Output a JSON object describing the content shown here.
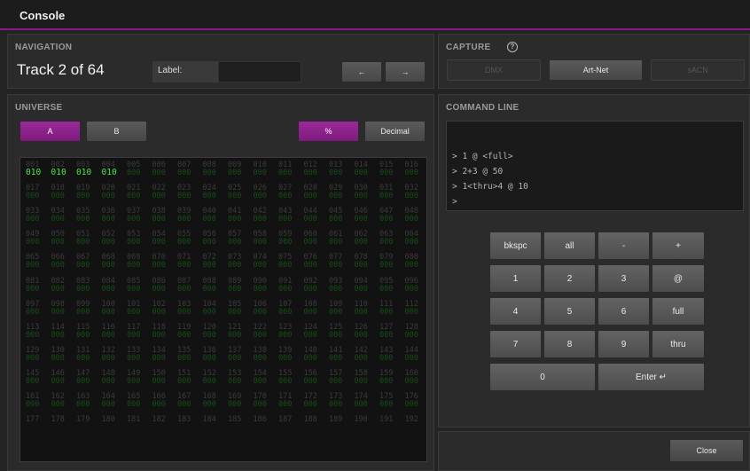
{
  "window": {
    "title": "Console"
  },
  "navigation": {
    "header": "NAVIGATION",
    "track_text": "Track 2 of 64",
    "label_caption": "Label:",
    "label_value": "",
    "prev_label": "←",
    "next_label": "→"
  },
  "capture": {
    "header": "CAPTURE",
    "help_icon": "question-circle-icon",
    "buttons": [
      "DMX",
      "Art-Net",
      "sACN"
    ]
  },
  "universe": {
    "header": "UNIVERSE",
    "tab_a": "A",
    "tab_b": "B",
    "mode_percent": "%",
    "mode_decimal": "Decimal",
    "cells": [
      {
        "ch": "001",
        "val": "010"
      },
      {
        "ch": "002",
        "val": "010"
      },
      {
        "ch": "003",
        "val": "010"
      },
      {
        "ch": "004",
        "val": "010"
      },
      {
        "ch": "005",
        "val": "000"
      },
      {
        "ch": "006",
        "val": "000"
      },
      {
        "ch": "007",
        "val": "000"
      },
      {
        "ch": "008",
        "val": "000"
      },
      {
        "ch": "009",
        "val": "000"
      },
      {
        "ch": "010",
        "val": "000"
      },
      {
        "ch": "011",
        "val": "000"
      },
      {
        "ch": "012",
        "val": "000"
      },
      {
        "ch": "013",
        "val": "000"
      },
      {
        "ch": "014",
        "val": "000"
      },
      {
        "ch": "015",
        "val": "000"
      },
      {
        "ch": "016",
        "val": "000"
      },
      {
        "ch": "017",
        "val": "000"
      },
      {
        "ch": "018",
        "val": "000"
      },
      {
        "ch": "019",
        "val": "000"
      },
      {
        "ch": "020",
        "val": "000"
      },
      {
        "ch": "021",
        "val": "000"
      },
      {
        "ch": "022",
        "val": "000"
      },
      {
        "ch": "023",
        "val": "000"
      },
      {
        "ch": "024",
        "val": "000"
      },
      {
        "ch": "025",
        "val": "000"
      },
      {
        "ch": "026",
        "val": "000"
      },
      {
        "ch": "027",
        "val": "000"
      },
      {
        "ch": "028",
        "val": "000"
      },
      {
        "ch": "029",
        "val": "000"
      },
      {
        "ch": "030",
        "val": "000"
      },
      {
        "ch": "031",
        "val": "000"
      },
      {
        "ch": "032",
        "val": "000"
      },
      {
        "ch": "033",
        "val": "000"
      },
      {
        "ch": "034",
        "val": "000"
      },
      {
        "ch": "035",
        "val": "000"
      },
      {
        "ch": "036",
        "val": "000"
      },
      {
        "ch": "037",
        "val": "000"
      },
      {
        "ch": "038",
        "val": "000"
      },
      {
        "ch": "039",
        "val": "000"
      },
      {
        "ch": "040",
        "val": "000"
      },
      {
        "ch": "041",
        "val": "000"
      },
      {
        "ch": "042",
        "val": "000"
      },
      {
        "ch": "043",
        "val": "000"
      },
      {
        "ch": "044",
        "val": "000"
      },
      {
        "ch": "045",
        "val": "000"
      },
      {
        "ch": "046",
        "val": "000"
      },
      {
        "ch": "047",
        "val": "000"
      },
      {
        "ch": "048",
        "val": "000"
      },
      {
        "ch": "049",
        "val": "000"
      },
      {
        "ch": "050",
        "val": "000"
      },
      {
        "ch": "051",
        "val": "000"
      },
      {
        "ch": "052",
        "val": "000"
      },
      {
        "ch": "053",
        "val": "000"
      },
      {
        "ch": "054",
        "val": "000"
      },
      {
        "ch": "055",
        "val": "000"
      },
      {
        "ch": "056",
        "val": "000"
      },
      {
        "ch": "057",
        "val": "000"
      },
      {
        "ch": "058",
        "val": "000"
      },
      {
        "ch": "059",
        "val": "000"
      },
      {
        "ch": "060",
        "val": "000"
      },
      {
        "ch": "061",
        "val": "000"
      },
      {
        "ch": "062",
        "val": "000"
      },
      {
        "ch": "063",
        "val": "000"
      },
      {
        "ch": "064",
        "val": "000"
      },
      {
        "ch": "065",
        "val": "000"
      },
      {
        "ch": "066",
        "val": "000"
      },
      {
        "ch": "067",
        "val": "000"
      },
      {
        "ch": "068",
        "val": "000"
      },
      {
        "ch": "069",
        "val": "000"
      },
      {
        "ch": "070",
        "val": "000"
      },
      {
        "ch": "071",
        "val": "000"
      },
      {
        "ch": "072",
        "val": "000"
      },
      {
        "ch": "073",
        "val": "000"
      },
      {
        "ch": "074",
        "val": "000"
      },
      {
        "ch": "075",
        "val": "000"
      },
      {
        "ch": "076",
        "val": "000"
      },
      {
        "ch": "077",
        "val": "000"
      },
      {
        "ch": "078",
        "val": "000"
      },
      {
        "ch": "079",
        "val": "000"
      },
      {
        "ch": "080",
        "val": "000"
      },
      {
        "ch": "081",
        "val": "000"
      },
      {
        "ch": "082",
        "val": "000"
      },
      {
        "ch": "083",
        "val": "000"
      },
      {
        "ch": "084",
        "val": "000"
      },
      {
        "ch": "085",
        "val": "000"
      },
      {
        "ch": "086",
        "val": "000"
      },
      {
        "ch": "087",
        "val": "000"
      },
      {
        "ch": "088",
        "val": "000"
      },
      {
        "ch": "089",
        "val": "000"
      },
      {
        "ch": "090",
        "val": "000"
      },
      {
        "ch": "091",
        "val": "000"
      },
      {
        "ch": "092",
        "val": "000"
      },
      {
        "ch": "093",
        "val": "000"
      },
      {
        "ch": "094",
        "val": "000"
      },
      {
        "ch": "095",
        "val": "000"
      },
      {
        "ch": "096",
        "val": "000"
      },
      {
        "ch": "097",
        "val": "000"
      },
      {
        "ch": "098",
        "val": "000"
      },
      {
        "ch": "099",
        "val": "000"
      },
      {
        "ch": "100",
        "val": "000"
      },
      {
        "ch": "101",
        "val": "000"
      },
      {
        "ch": "102",
        "val": "000"
      },
      {
        "ch": "103",
        "val": "000"
      },
      {
        "ch": "104",
        "val": "000"
      },
      {
        "ch": "105",
        "val": "000"
      },
      {
        "ch": "106",
        "val": "000"
      },
      {
        "ch": "107",
        "val": "000"
      },
      {
        "ch": "108",
        "val": "000"
      },
      {
        "ch": "109",
        "val": "000"
      },
      {
        "ch": "110",
        "val": "000"
      },
      {
        "ch": "111",
        "val": "000"
      },
      {
        "ch": "112",
        "val": "000"
      },
      {
        "ch": "113",
        "val": "000"
      },
      {
        "ch": "114",
        "val": "000"
      },
      {
        "ch": "115",
        "val": "000"
      },
      {
        "ch": "116",
        "val": "000"
      },
      {
        "ch": "117",
        "val": "000"
      },
      {
        "ch": "118",
        "val": "000"
      },
      {
        "ch": "119",
        "val": "000"
      },
      {
        "ch": "120",
        "val": "000"
      },
      {
        "ch": "121",
        "val": "000"
      },
      {
        "ch": "122",
        "val": "000"
      },
      {
        "ch": "123",
        "val": "000"
      },
      {
        "ch": "124",
        "val": "000"
      },
      {
        "ch": "125",
        "val": "000"
      },
      {
        "ch": "126",
        "val": "000"
      },
      {
        "ch": "127",
        "val": "000"
      },
      {
        "ch": "128",
        "val": "000"
      },
      {
        "ch": "129",
        "val": "000"
      },
      {
        "ch": "130",
        "val": "000"
      },
      {
        "ch": "131",
        "val": "000"
      },
      {
        "ch": "132",
        "val": "000"
      },
      {
        "ch": "133",
        "val": "000"
      },
      {
        "ch": "134",
        "val": "000"
      },
      {
        "ch": "135",
        "val": "000"
      },
      {
        "ch": "136",
        "val": "000"
      },
      {
        "ch": "137",
        "val": "000"
      },
      {
        "ch": "138",
        "val": "000"
      },
      {
        "ch": "139",
        "val": "000"
      },
      {
        "ch": "140",
        "val": "000"
      },
      {
        "ch": "141",
        "val": "000"
      },
      {
        "ch": "142",
        "val": "000"
      },
      {
        "ch": "143",
        "val": "000"
      },
      {
        "ch": "144",
        "val": "000"
      },
      {
        "ch": "145",
        "val": "000"
      },
      {
        "ch": "146",
        "val": "000"
      },
      {
        "ch": "147",
        "val": "000"
      },
      {
        "ch": "148",
        "val": "000"
      },
      {
        "ch": "149",
        "val": "000"
      },
      {
        "ch": "150",
        "val": "000"
      },
      {
        "ch": "151",
        "val": "000"
      },
      {
        "ch": "152",
        "val": "000"
      },
      {
        "ch": "153",
        "val": "000"
      },
      {
        "ch": "154",
        "val": "000"
      },
      {
        "ch": "155",
        "val": "000"
      },
      {
        "ch": "156",
        "val": "000"
      },
      {
        "ch": "157",
        "val": "000"
      },
      {
        "ch": "158",
        "val": "000"
      },
      {
        "ch": "159",
        "val": "000"
      },
      {
        "ch": "160",
        "val": "000"
      },
      {
        "ch": "161",
        "val": "000"
      },
      {
        "ch": "162",
        "val": "000"
      },
      {
        "ch": "163",
        "val": "000"
      },
      {
        "ch": "164",
        "val": "000"
      },
      {
        "ch": "165",
        "val": "000"
      },
      {
        "ch": "166",
        "val": "000"
      },
      {
        "ch": "167",
        "val": "000"
      },
      {
        "ch": "168",
        "val": "000"
      },
      {
        "ch": "169",
        "val": "000"
      },
      {
        "ch": "170",
        "val": "000"
      },
      {
        "ch": "171",
        "val": "000"
      },
      {
        "ch": "172",
        "val": "000"
      },
      {
        "ch": "173",
        "val": "000"
      },
      {
        "ch": "174",
        "val": "000"
      },
      {
        "ch": "175",
        "val": "000"
      },
      {
        "ch": "176",
        "val": "000"
      },
      {
        "ch": "177",
        "val": ""
      },
      {
        "ch": "178",
        "val": ""
      },
      {
        "ch": "179",
        "val": ""
      },
      {
        "ch": "180",
        "val": ""
      },
      {
        "ch": "181",
        "val": ""
      },
      {
        "ch": "182",
        "val": ""
      },
      {
        "ch": "183",
        "val": ""
      },
      {
        "ch": "184",
        "val": ""
      },
      {
        "ch": "185",
        "val": ""
      },
      {
        "ch": "186",
        "val": ""
      },
      {
        "ch": "187",
        "val": ""
      },
      {
        "ch": "188",
        "val": ""
      },
      {
        "ch": "189",
        "val": ""
      },
      {
        "ch": "190",
        "val": ""
      },
      {
        "ch": "191",
        "val": ""
      },
      {
        "ch": "192",
        "val": ""
      }
    ]
  },
  "command_line": {
    "header": "COMMAND LINE",
    "lines": [
      "> 1 @ <full>",
      "> 2+3 @ 50",
      "> 1<thru>4 @ 10",
      ">"
    ]
  },
  "keypad": {
    "keys": [
      "bkspc",
      "all",
      "-",
      "+",
      "1",
      "2",
      "3",
      "@",
      "4",
      "5",
      "6",
      "full",
      "7",
      "8",
      "9",
      "thru",
      "0",
      "Enter ↵"
    ]
  },
  "footer": {
    "close_label": "Close"
  },
  "colors": {
    "accent": "#8a1a8a",
    "active_value": "#46ec46",
    "idle_value": "#174d17"
  }
}
